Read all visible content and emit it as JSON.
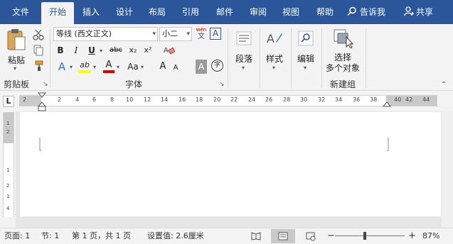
{
  "tabs": [
    "文件",
    "开始",
    "插入",
    "设计",
    "布局",
    "引用",
    "邮件",
    "审阅",
    "视图",
    "帮助"
  ],
  "active_tab": "开始",
  "tell_me": "告诉我",
  "share": "共享",
  "clipboard": {
    "paste": "粘贴",
    "group": "剪贴板"
  },
  "font": {
    "name": "等线 (西文正文)",
    "size": "小二",
    "wen_top": "wén",
    "wen_bottom": "文",
    "group": "字体",
    "bold": "B",
    "italic": "I",
    "underline": "U",
    "strike": "abc",
    "sub": "x₂",
    "sup": "x²",
    "effect": "A",
    "highlight": "ab",
    "color": "A",
    "case": "Aa",
    "grow": "A",
    "shrink": "A",
    "shade": "A",
    "encircle": "字"
  },
  "paragraph": {
    "label": "段落"
  },
  "styles": {
    "label": "样式"
  },
  "editing": {
    "label": "编辑"
  },
  "new_group": {
    "label_line1": "选择",
    "label_line2": "多个对象",
    "group": "新建组"
  },
  "ruler": {
    "tab_selector": "L",
    "ticks": [
      "2",
      "2",
      "4",
      "6",
      "8",
      "10",
      "12",
      "14",
      "16",
      "18",
      "20",
      "22",
      "24",
      "26",
      "28",
      "30",
      "32",
      "34",
      "36",
      "38",
      "40",
      "42",
      "44"
    ]
  },
  "vruler": {
    "ticks": [
      "1",
      "2",
      "1",
      "2",
      "1",
      "4"
    ]
  },
  "status": {
    "page": "页面: 1",
    "section": "节: 1",
    "pages": "第 1 页，共 1 页",
    "setting": "设置值: 2.6厘米",
    "zoom": "87%"
  },
  "colors": {
    "accent": "#2b579a",
    "highlight": "#ffff00",
    "font_color": "#e00000"
  }
}
